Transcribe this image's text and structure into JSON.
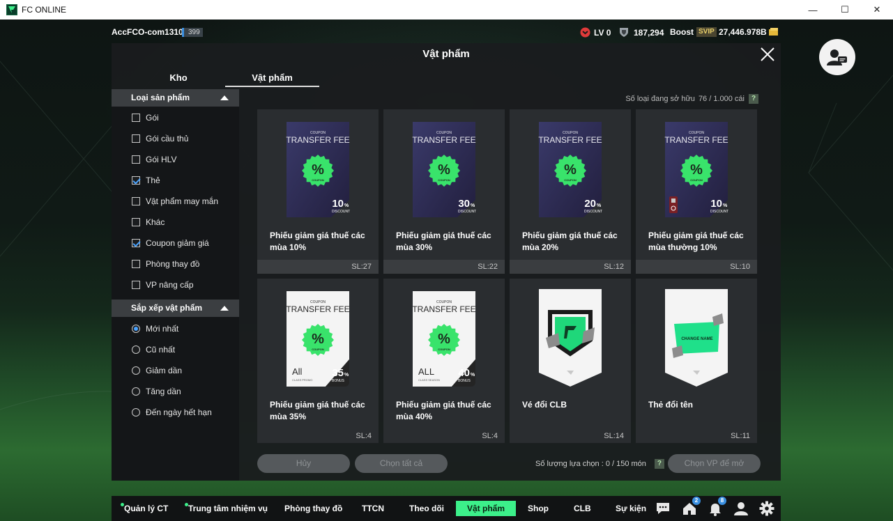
{
  "window": {
    "title": "FC ONLINE",
    "min": "—",
    "max": "☐",
    "close": "✕"
  },
  "topbar": {
    "account": "AccFCO-com1310b",
    "account_badge": "399",
    "level": "LV 0",
    "trophies": "187,294",
    "boost": "Boost",
    "svip": "SVIP",
    "coins": "27,446.978B"
  },
  "modal": {
    "title": "Vật phẩm",
    "tabs": [
      {
        "label": "Kho"
      },
      {
        "label": "Vật phẩm"
      }
    ],
    "owned_label": "Số loại đang sở hữu",
    "owned_value": "76 / 1.000 cái",
    "help": "?"
  },
  "sidebar": {
    "product_type_heading": "Loại sản phẩm",
    "product_types": [
      {
        "label": "Gói",
        "checked": false
      },
      {
        "label": "Gói cầu thủ",
        "checked": false
      },
      {
        "label": "Gói HLV",
        "checked": false
      },
      {
        "label": "Thẻ",
        "checked": true
      },
      {
        "label": "Vật phẩm may mắn",
        "checked": false
      },
      {
        "label": "Khác",
        "checked": false
      },
      {
        "label": "Coupon giảm giá",
        "checked": true
      },
      {
        "label": "Phòng thay đồ",
        "checked": false
      },
      {
        "label": "VP nâng cấp",
        "checked": false
      }
    ],
    "sort_heading": "Sắp xếp vật phẩm",
    "sort_options": [
      {
        "label": "Mới nhất",
        "selected": true
      },
      {
        "label": "Cũ nhất",
        "selected": false
      },
      {
        "label": "Giảm dần",
        "selected": false
      },
      {
        "label": "Tăng dần",
        "selected": false
      },
      {
        "label": "Đến ngày hết hạn",
        "selected": false
      }
    ]
  },
  "items": [
    {
      "name": "Phiếu giảm giá thuế các mùa 10%",
      "qty": "SL:27",
      "coupon_top": "COUPON",
      "coupon_title": "TRANSFER FEE",
      "percent": "10",
      "unit": "%",
      "sub": "DISCOUNT",
      "style": "dark",
      "badge_text": "COUPON"
    },
    {
      "name": "Phiếu giảm giá thuế các mùa 30%",
      "qty": "SL:22",
      "coupon_top": "COUPON",
      "coupon_title": "TRANSFER FEE",
      "percent": "30",
      "unit": "%",
      "sub": "DISCOUNT",
      "style": "dark",
      "badge_text": "COUPON"
    },
    {
      "name": "Phiếu giảm giá thuế các mùa 20%",
      "qty": "SL:12",
      "coupon_top": "COUPON",
      "coupon_title": "TRANSFER FEE",
      "percent": "20",
      "unit": "%",
      "sub": "DISCOUNT",
      "style": "dark",
      "badge_text": "COUPON"
    },
    {
      "name": "Phiếu giảm giá thuế các mùa thường 10%",
      "qty": "SL:10",
      "coupon_top": "COUPON",
      "coupon_title": "TRANSFER FEE",
      "percent": "10",
      "unit": "%",
      "sub": "DISCOUNT",
      "style": "dark-red",
      "badge_text": "COUPON"
    },
    {
      "name": "Phiếu giảm giá thuế các mùa 35%",
      "qty": "SL:4",
      "coupon_top": "COUPON",
      "coupon_title": "TRANSFER FEE",
      "percent": "35",
      "unit": "%",
      "sub": "BONUS",
      "style": "white",
      "badge_text": "COUPON",
      "all_label": "All",
      "all_sub": "CLASS PROMO"
    },
    {
      "name": "Phiếu giảm giá thuế các mùa 40%",
      "qty": "SL:4",
      "coupon_top": "COUPON",
      "coupon_title": "TRANSFER FEE",
      "percent": "40",
      "unit": "%",
      "sub": "BONUS",
      "style": "white",
      "badge_text": "COUPON",
      "all_label": "ALL",
      "all_sub": "CLASS SEASON"
    },
    {
      "name": "Vé đổi CLB",
      "qty": "SL:14",
      "style": "club"
    },
    {
      "name": "Thẻ đổi tên",
      "qty": "SL:11",
      "style": "rename",
      "ticket_text": "CHANGE NAME"
    }
  ],
  "actions": {
    "cancel": "Hủy",
    "select_all": "Chọn tất cả",
    "selected_label": "Số lượng lựa chọn : 0 / 150 món",
    "open": "Chọn VP để mở"
  },
  "bottomnav": {
    "items": [
      {
        "label": "Quản lý CT",
        "dot": true
      },
      {
        "label": "Trung tâm nhiệm vụ",
        "dot": true
      },
      {
        "label": "Phòng thay đồ",
        "dot": false
      },
      {
        "label": "TTCN",
        "dot": false
      },
      {
        "label": "Theo dõi",
        "dot": false
      },
      {
        "label": "Vật phẩm",
        "dot": false,
        "active": true
      },
      {
        "label": "Shop",
        "dot": false
      },
      {
        "label": "CLB",
        "dot": false
      },
      {
        "label": "Sự kiện",
        "dot": false
      }
    ],
    "home_badge": "2",
    "bell_badge": "8"
  },
  "colors": {
    "accent_green": "#3cf08a",
    "coupon_green": "#39e36b",
    "checkbox_blue": "#4aa3ff"
  }
}
